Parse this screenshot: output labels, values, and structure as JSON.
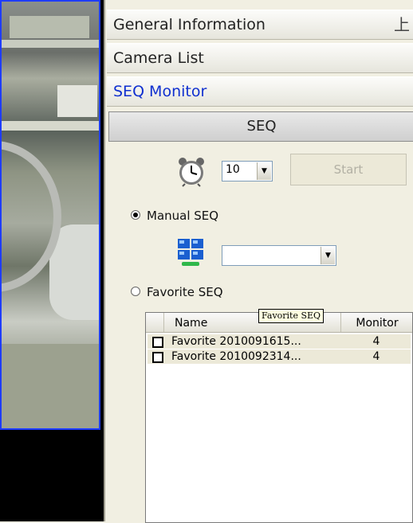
{
  "panel": {
    "headers": [
      {
        "label": "General Information"
      },
      {
        "label": "Camera List"
      },
      {
        "label": "SEQ Monitor"
      }
    ],
    "pin_glyph": "上",
    "seq_title": "SEQ",
    "interval": {
      "value": "10"
    },
    "start_label": "Start",
    "manual_label": "Manual SEQ",
    "manual_combo_value": "",
    "favorite_label": "Favorite SEQ",
    "tooltip": "Favorite SEQ",
    "table": {
      "columns": [
        "Name",
        "Monitor"
      ],
      "rows": [
        {
          "name": "Favorite 2010091615...",
          "monitor": "4"
        },
        {
          "name": "Favorite 2010092314...",
          "monitor": "4"
        }
      ]
    }
  },
  "colors": {
    "accent": "#1030d0",
    "camera_border": "#1e3cff"
  },
  "icons": [
    "alarm-clock-icon",
    "monitor-grid-icon",
    "pin-icon",
    "dropdown-arrow-icon"
  ]
}
